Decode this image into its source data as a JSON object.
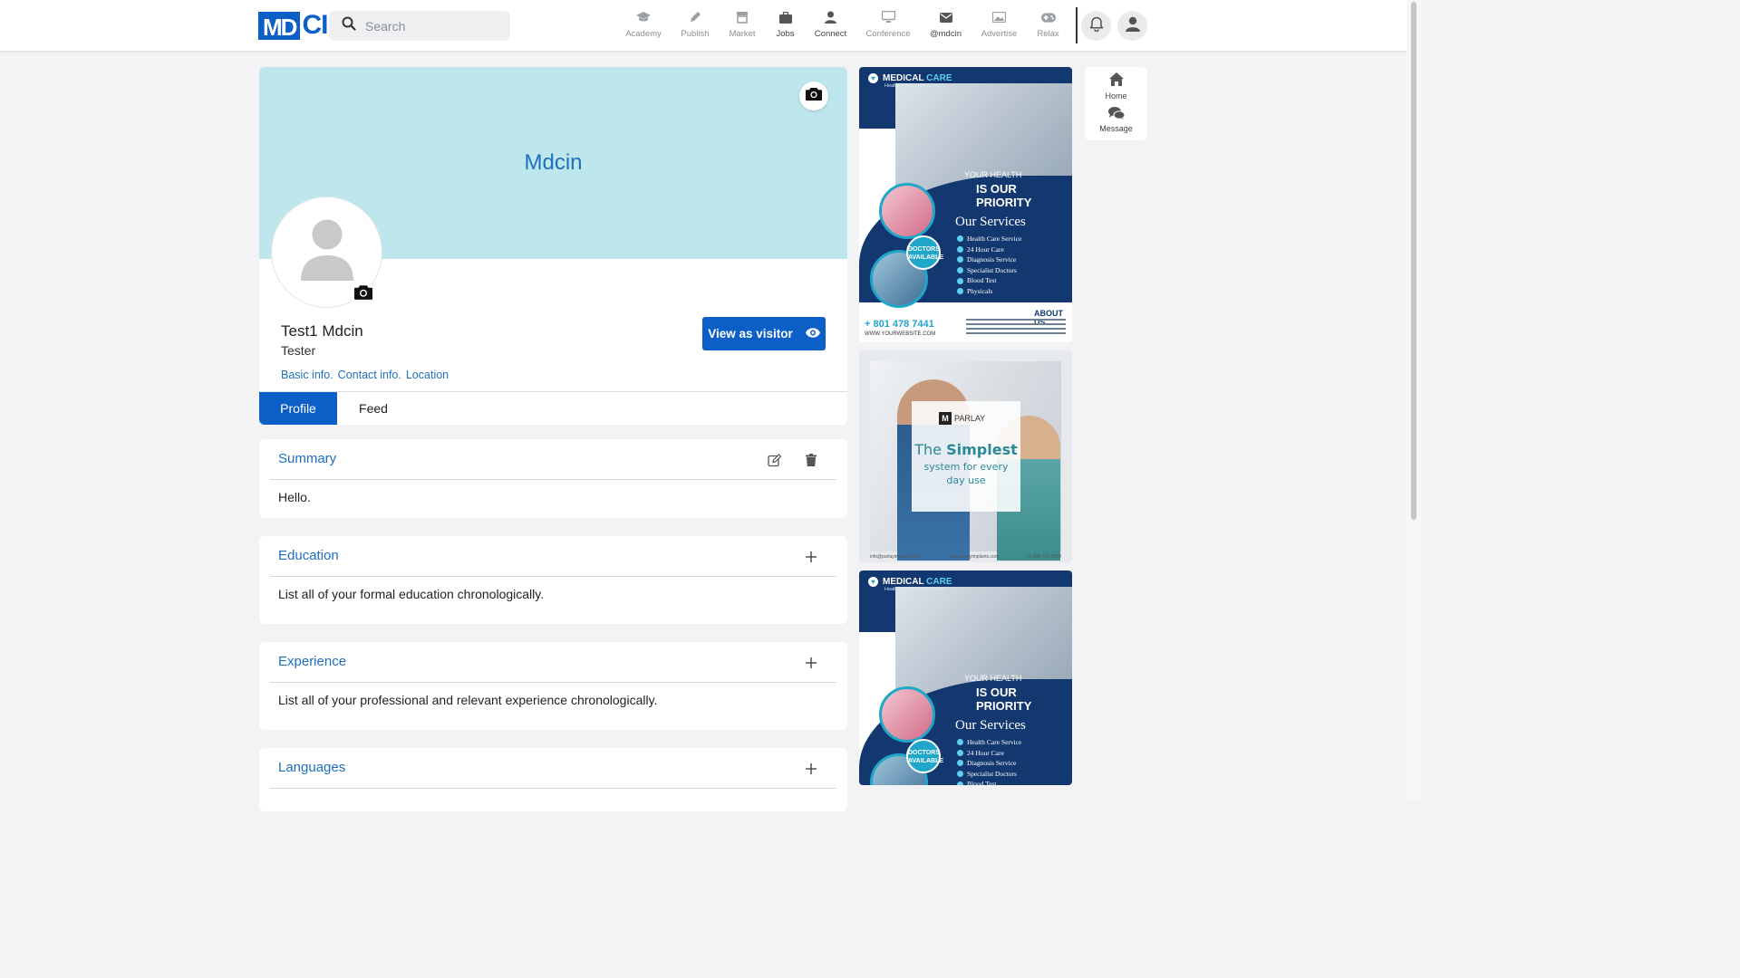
{
  "brand": {
    "logo_md": "MD",
    "logo_cin": "CIN"
  },
  "search": {
    "placeholder": "Search",
    "value": ""
  },
  "nav": {
    "items": [
      {
        "label": "Academy",
        "icon": "graduation-cap-icon"
      },
      {
        "label": "Publish",
        "icon": "pencil-icon"
      },
      {
        "label": "Market",
        "icon": "store-icon"
      },
      {
        "label": "Jobs",
        "icon": "briefcase-icon"
      },
      {
        "label": "Connect",
        "icon": "user-icon"
      },
      {
        "label": "Conference",
        "icon": "monitor-icon"
      },
      {
        "label": "@mdcin",
        "icon": "envelope-icon"
      },
      {
        "label": "Advertise",
        "icon": "image-icon"
      },
      {
        "label": "Relax",
        "icon": "gamepad-icon"
      }
    ],
    "active": [
      "Jobs",
      "Connect",
      "@mdcin"
    ]
  },
  "profile": {
    "cover_title": "Mdcin",
    "name": "Test1 Mdcin",
    "role": "Tester",
    "links": [
      "Basic info.",
      "Contact info.",
      "Location"
    ],
    "view_as_visitor": "View as visitor",
    "tabs": [
      "Profile",
      "Feed"
    ],
    "active_tab": "Profile"
  },
  "sections": {
    "summary": {
      "title": "Summary",
      "body": "Hello."
    },
    "education": {
      "title": "Education",
      "body": "List all of your formal education chronologically."
    },
    "experience": {
      "title": "Experience",
      "body": "List all of your professional and relevant experience chronologically."
    },
    "languages": {
      "title": "Languages",
      "body": ""
    }
  },
  "ads": {
    "medical": {
      "brand_1": "MEDICAL",
      "brand_2": "CARE",
      "brand_sub": "Health & Wellness Support",
      "tagline_1": "YOUR HEALTH",
      "tagline_2": "IS OUR PRIORITY",
      "badge_1": "DOCTORS",
      "badge_2": "AVAILABLE",
      "services_title": "Our Services",
      "services": [
        "Health Care Service",
        "24 Hour Care",
        "Diagnosis Service",
        "Specialist Doctors",
        "Blood Test",
        "Physicals"
      ],
      "phone": "+ 801 478 7441",
      "website": "WWW.YOURWEBSITE.COM",
      "about": "ABOUT US"
    },
    "dental": {
      "logo_letter": "M",
      "logo_text": "PARLAY",
      "title_1": "The",
      "title_2": "Simplest",
      "subtitle_1": "system for every",
      "subtitle_2": "day use",
      "foot_1": "info@parlayimplants.com",
      "foot_2": "www.parlayimplants.com",
      "foot_3": "+1 800-727-5299"
    }
  },
  "quick_panel": {
    "home": "Home",
    "message": "Message"
  },
  "colors": {
    "brand_blue": "#0b5fc6",
    "link_blue": "#1f6fbf",
    "cover": "#bde6ed",
    "page_bg": "#f3f3f5"
  }
}
